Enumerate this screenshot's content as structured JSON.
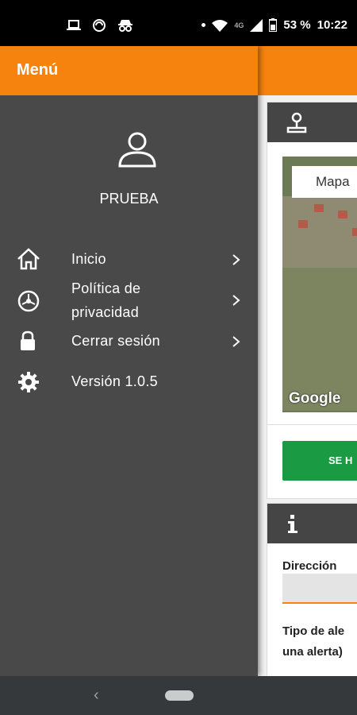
{
  "status_bar": {
    "battery_percent": "53 %",
    "time": "10:22",
    "network_type": "4G",
    "left_icons": [
      "laptop-icon",
      "screen-sync-icon",
      "incognito-icon"
    ],
    "right_icons": [
      "dot-icon",
      "wifi-icon",
      "signal-icon",
      "battery-icon"
    ]
  },
  "drawer": {
    "title": "Menú",
    "username": "PRUEBA",
    "items": [
      {
        "label": "Inicio",
        "icon": "home-icon",
        "has_chevron": true
      },
      {
        "label_line1": "Política de",
        "label_line2": "privacidad",
        "icon": "policy-icon",
        "has_chevron": true
      },
      {
        "label": "Cerrar sesión",
        "icon": "lock-icon",
        "has_chevron": true
      },
      {
        "label": "Versión 1.0.5",
        "icon": "gear-icon",
        "has_chevron": false
      }
    ]
  },
  "background_app": {
    "map_type_label": "Mapa",
    "map_attribution": "Google",
    "action_button_label": "SE H",
    "address_label": "Dirección",
    "alert_type_label_line1": "Tipo de ale",
    "alert_type_label_line2": "una alerta)"
  },
  "colors": {
    "accent": "#f7830f",
    "drawer_bg": "#494949",
    "action_green": "#1a9b43",
    "navbar_bg": "#35393b"
  }
}
